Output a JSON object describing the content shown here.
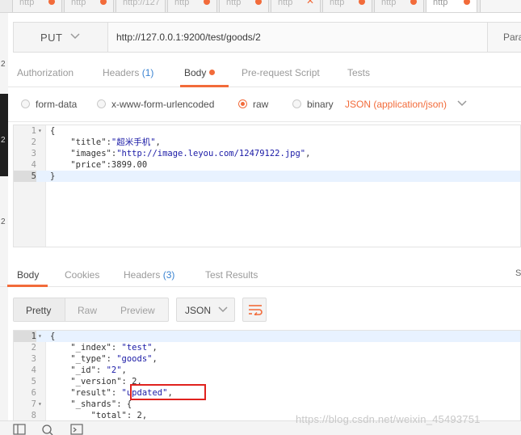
{
  "tabs": [
    {
      "label": "http",
      "marker": "dot"
    },
    {
      "label": "http",
      "marker": "dot"
    },
    {
      "label": "http://127",
      "marker": ""
    },
    {
      "label": "http",
      "marker": "dot"
    },
    {
      "label": "http",
      "marker": "dot"
    },
    {
      "label": "http",
      "marker": "close"
    },
    {
      "label": "http",
      "marker": "dot"
    },
    {
      "label": "http",
      "marker": "dot"
    },
    {
      "label": "http",
      "marker": "dot"
    }
  ],
  "request": {
    "method": "PUT",
    "url": "http://127.0.0.1:9200/test/goods/2",
    "params_label": "Para"
  },
  "request_tabs": {
    "authorization": "Authorization",
    "headers": "Headers",
    "headers_count": "(1)",
    "body": "Body",
    "prerequest": "Pre-request Script",
    "tests": "Tests"
  },
  "body_types": {
    "form_data": "form-data",
    "urlencoded": "x-www-form-urlencoded",
    "raw": "raw",
    "binary": "binary",
    "selected": "raw",
    "content_type": "JSON (application/json)"
  },
  "request_body": {
    "lines": [
      {
        "num": "1",
        "fold": true,
        "parts": [
          [
            "p",
            "{"
          ]
        ]
      },
      {
        "num": "2",
        "fold": false,
        "parts": [
          [
            "p",
            "    "
          ],
          [
            "k",
            "\"title\""
          ],
          [
            "p",
            ":"
          ],
          [
            "s",
            "\"超米手机\""
          ],
          [
            "p",
            ","
          ]
        ]
      },
      {
        "num": "3",
        "fold": false,
        "parts": [
          [
            "p",
            "    "
          ],
          [
            "k",
            "\"images\""
          ],
          [
            "p",
            ":"
          ],
          [
            "s",
            "\"http://image.leyou.com/12479122.jpg\""
          ],
          [
            "p",
            ","
          ]
        ]
      },
      {
        "num": "4",
        "fold": false,
        "parts": [
          [
            "p",
            "    "
          ],
          [
            "k",
            "\"price\""
          ],
          [
            "p",
            ":"
          ],
          [
            "n",
            "3899.00"
          ]
        ]
      },
      {
        "num": "5",
        "fold": false,
        "parts": [
          [
            "p",
            "}"
          ]
        ],
        "highlight": true
      }
    ]
  },
  "response_tabs": {
    "body": "Body",
    "cookies": "Cookies",
    "headers": "Headers",
    "headers_count": "(3)",
    "test_results": "Test Results",
    "status_partial": "S"
  },
  "response_view": {
    "pretty": "Pretty",
    "raw": "Raw",
    "preview": "Preview",
    "format": "JSON"
  },
  "response_body": {
    "lines": [
      {
        "num": "1",
        "fold": true,
        "parts": [
          [
            "p",
            "{"
          ]
        ],
        "highlight": true
      },
      {
        "num": "2",
        "fold": false,
        "parts": [
          [
            "p",
            "    "
          ],
          [
            "k",
            "\"_index\""
          ],
          [
            "p",
            ": "
          ],
          [
            "s",
            "\"test\""
          ],
          [
            "p",
            ","
          ]
        ]
      },
      {
        "num": "3",
        "fold": false,
        "parts": [
          [
            "p",
            "    "
          ],
          [
            "k",
            "\"_type\""
          ],
          [
            "p",
            ": "
          ],
          [
            "s",
            "\"goods\""
          ],
          [
            "p",
            ","
          ]
        ]
      },
      {
        "num": "4",
        "fold": false,
        "parts": [
          [
            "p",
            "    "
          ],
          [
            "k",
            "\"_id\""
          ],
          [
            "p",
            ": "
          ],
          [
            "s",
            "\"2\""
          ],
          [
            "p",
            ","
          ]
        ]
      },
      {
        "num": "5",
        "fold": false,
        "parts": [
          [
            "p",
            "    "
          ],
          [
            "k",
            "\"_version\""
          ],
          [
            "p",
            ": "
          ],
          [
            "n",
            "2"
          ],
          [
            "p",
            ","
          ]
        ]
      },
      {
        "num": "6",
        "fold": false,
        "parts": [
          [
            "p",
            "    "
          ],
          [
            "k",
            "\"result\""
          ],
          [
            "p",
            ": "
          ],
          [
            "s",
            "\"updated\""
          ],
          [
            "p",
            ","
          ]
        ]
      },
      {
        "num": "7",
        "fold": true,
        "parts": [
          [
            "p",
            "    "
          ],
          [
            "k",
            "\"_shards\""
          ],
          [
            "p",
            ": {"
          ]
        ]
      },
      {
        "num": "8",
        "fold": false,
        "parts": [
          [
            "p",
            "        "
          ],
          [
            "k",
            "\"total\""
          ],
          [
            "p",
            ": "
          ],
          [
            "n",
            "2"
          ],
          [
            "p",
            ","
          ]
        ]
      }
    ]
  },
  "left_strip_numbers": [
    "2",
    "2",
    "2"
  ],
  "watermark": "https://blog.csdn.net/weixin_45493751",
  "colors": {
    "accent": "#f26b3a",
    "count_blue": "#3a83d1",
    "annotation_red": "#e0221e"
  }
}
